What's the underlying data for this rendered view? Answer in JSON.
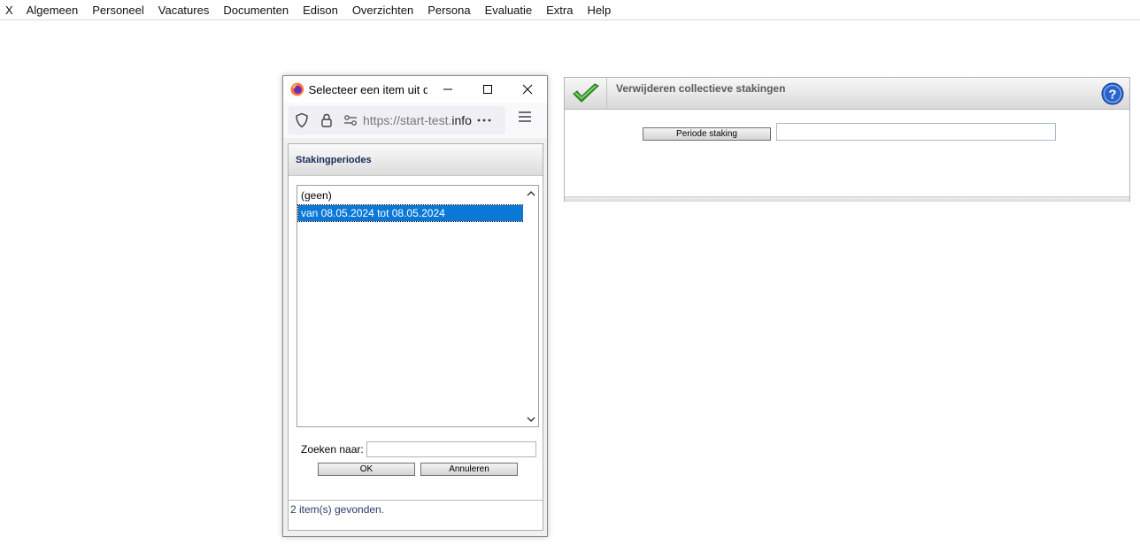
{
  "menu": {
    "items": [
      "X",
      "Algemeen",
      "Personeel",
      "Vacatures",
      "Documenten",
      "Edison",
      "Overzichten",
      "Persona",
      "Evaluatie",
      "Extra",
      "Help"
    ]
  },
  "popup": {
    "title": "Selecteer een item uit d...",
    "url_prefix": "https://start-test.",
    "url_domain": "info",
    "panel_title": "Stakingperiodes",
    "list_items": [
      "(geen)",
      "van 08.05.2024 tot 08.05.2024"
    ],
    "selected_index": 1,
    "search_label": "Zoeken naar:",
    "search_value": "",
    "ok_label": "OK",
    "cancel_label": "Annuleren",
    "status": "2 item(s) gevonden."
  },
  "main": {
    "title": "Verwijderen collectieve stakingen",
    "period_button": "Periode staking",
    "period_value": ""
  },
  "colors": {
    "selection": "#0a78d7",
    "panel_title": "#1a2a5a",
    "check_green": "#3aa62a",
    "help_blue": "#2a64c8"
  }
}
